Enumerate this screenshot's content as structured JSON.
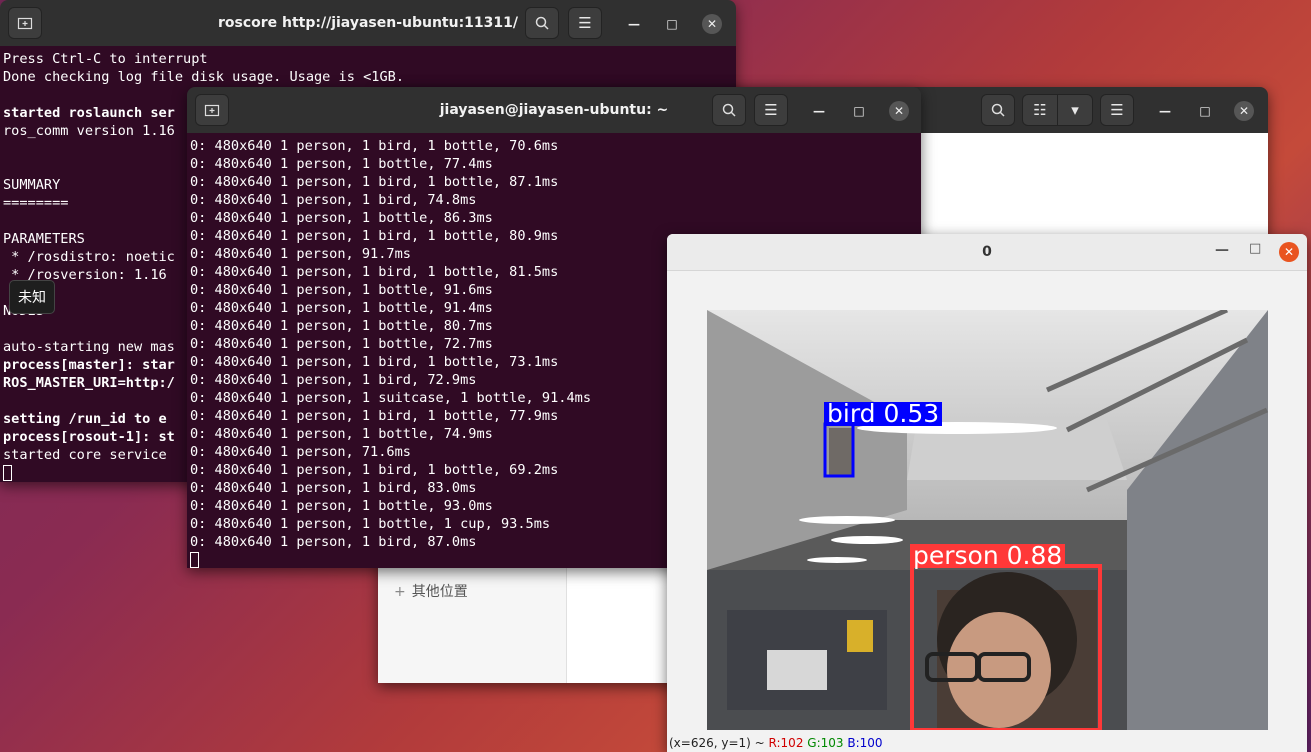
{
  "roscore_window": {
    "title": "roscore http://jiayasen-ubuntu:11311/",
    "lines": [
      {
        "t": "Press Ctrl-C to interrupt",
        "b": false
      },
      {
        "t": "Done checking log file disk usage. Usage is <1GB.",
        "b": false
      },
      {
        "t": "",
        "b": false
      },
      {
        "t": "started roslaunch ser",
        "b": true
      },
      {
        "t": "ros_comm version 1.16",
        "b": false
      },
      {
        "t": "",
        "b": false
      },
      {
        "t": "",
        "b": false
      },
      {
        "t": "SUMMARY",
        "b": false
      },
      {
        "t": "========",
        "b": false
      },
      {
        "t": "",
        "b": false
      },
      {
        "t": "PARAMETERS",
        "b": false
      },
      {
        "t": " * /rosdistro: noetic",
        "b": false
      },
      {
        "t": " * /rosversion: 1.16",
        "b": false
      },
      {
        "t": "",
        "b": false
      },
      {
        "t": "NODES",
        "b": false
      },
      {
        "t": "",
        "b": false
      },
      {
        "t": "auto-starting new mas",
        "b": false
      },
      {
        "t": "process[master]: star",
        "b": true
      },
      {
        "t": "ROS_MASTER_URI=http:/",
        "b": true
      },
      {
        "t": "",
        "b": false
      },
      {
        "t": "setting /run_id to e",
        "b": true
      },
      {
        "t": "process[rosout-1]: st",
        "b": true
      },
      {
        "t": "started core service",
        "b": false
      }
    ]
  },
  "tooltip": "未知",
  "main_terminal": {
    "title": "jiayasen@jiayasen-ubuntu: ~",
    "lines": [
      "0: 480x640 1 person, 1 bird, 1 bottle, 70.6ms",
      "0: 480x640 1 person, 1 bottle, 77.4ms",
      "0: 480x640 1 person, 1 bird, 1 bottle, 87.1ms",
      "0: 480x640 1 person, 1 bird, 74.8ms",
      "0: 480x640 1 person, 1 bottle, 86.3ms",
      "0: 480x640 1 person, 1 bird, 1 bottle, 80.9ms",
      "0: 480x640 1 person, 91.7ms",
      "0: 480x640 1 person, 1 bird, 1 bottle, 81.5ms",
      "0: 480x640 1 person, 1 bottle, 91.6ms",
      "0: 480x640 1 person, 1 bottle, 91.4ms",
      "0: 480x640 1 person, 1 bottle, 80.7ms",
      "0: 480x640 1 person, 1 bottle, 72.7ms",
      "0: 480x640 1 person, 1 bird, 1 bottle, 73.1ms",
      "0: 480x640 1 person, 1 bird, 72.9ms",
      "0: 480x640 1 person, 1 suitcase, 1 bottle, 91.4ms",
      "0: 480x640 1 person, 1 bird, 1 bottle, 77.9ms",
      "0: 480x640 1 person, 1 bottle, 74.9ms",
      "0: 480x640 1 person, 71.6ms",
      "0: 480x640 1 person, 1 bird, 1 bottle, 69.2ms",
      "0: 480x640 1 person, 1 bird, 83.0ms",
      "0: 480x640 1 person, 1 bottle, 93.0ms",
      "0: 480x640 1 person, 1 bottle, 1 cup, 93.5ms",
      "0: 480x640 1 person, 1 bird, 87.0ms"
    ]
  },
  "file_manager": {
    "other_locations": "其他位置"
  },
  "detection_window": {
    "title": "0",
    "detections": [
      {
        "label": "bird 0.53",
        "color": "#0000ff"
      },
      {
        "label": "person 0.88",
        "color": "#ff3838"
      }
    ],
    "status": {
      "coords": "(x=626, y=1) ~ ",
      "r": "R:102",
      "g": "G:103",
      "b": "B:100"
    }
  },
  "colors": {
    "terminal_bg": "#300a24",
    "titlebar": "#303030",
    "close_orange": "#e95420"
  }
}
